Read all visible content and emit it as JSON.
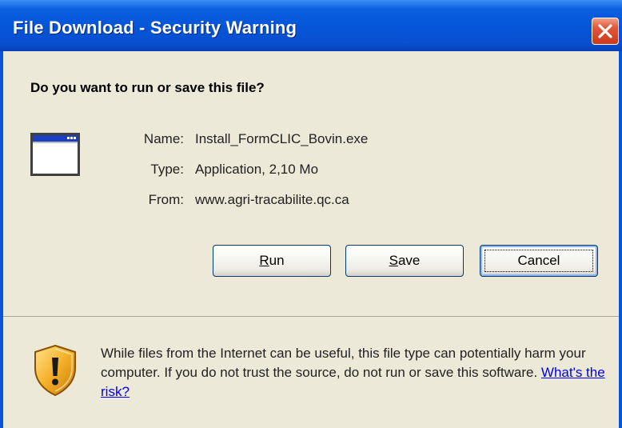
{
  "window": {
    "title": "File Download - Security Warning",
    "title_bar_color": "#0554d8",
    "body_color": "#ece9d8"
  },
  "prompt": {
    "question": "Do you want to run or save this file?"
  },
  "file_info": {
    "icon": "application-window-icon",
    "name_label": "Name:",
    "name_value": "Install_FormCLIC_Bovin.exe",
    "type_label": "Type:",
    "type_value": "Application, 2,10 Mo",
    "from_label": "From:",
    "from_value": "www.agri-tracabilite.qc.ca"
  },
  "buttons": {
    "run_mnemonic": "R",
    "run_rest": "un",
    "save_mnemonic": "S",
    "save_rest": "ave",
    "cancel_label": "Cancel"
  },
  "warning": {
    "icon": "security-shield-icon",
    "text": "While files from the Internet can be useful, this file type can potentially harm your computer. If you do not trust the source, do not run or save this software. ",
    "link_text": "What's the risk?"
  }
}
